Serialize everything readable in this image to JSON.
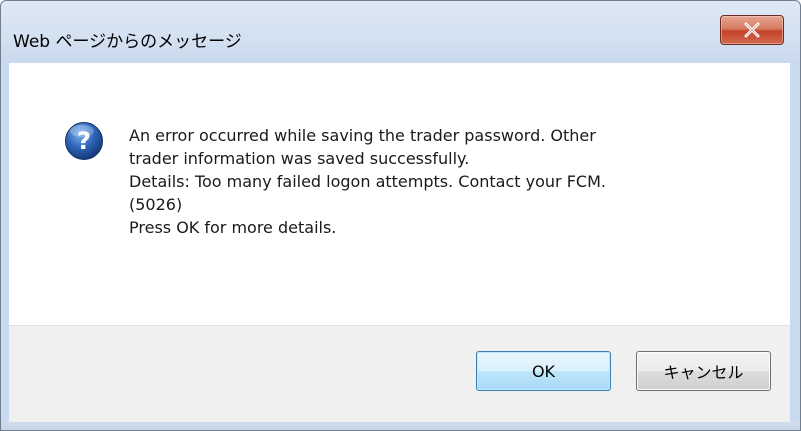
{
  "dialog": {
    "title": "Web ページからのメッセージ",
    "message_lines": [
      "An error occurred while saving the trader password. Other",
      "trader information was saved successfully.",
      "Details: Too many failed logon attempts. Contact your FCM.",
      "(5026)",
      "Press OK for more details."
    ],
    "icon": "question-icon",
    "close_icon": "close-icon",
    "ok_label": "OK",
    "cancel_label": "キャンセル"
  },
  "colors": {
    "close_button": "#c9482f",
    "ok_border": "#3c7fb1",
    "icon_blue": "#2a5ea8"
  }
}
